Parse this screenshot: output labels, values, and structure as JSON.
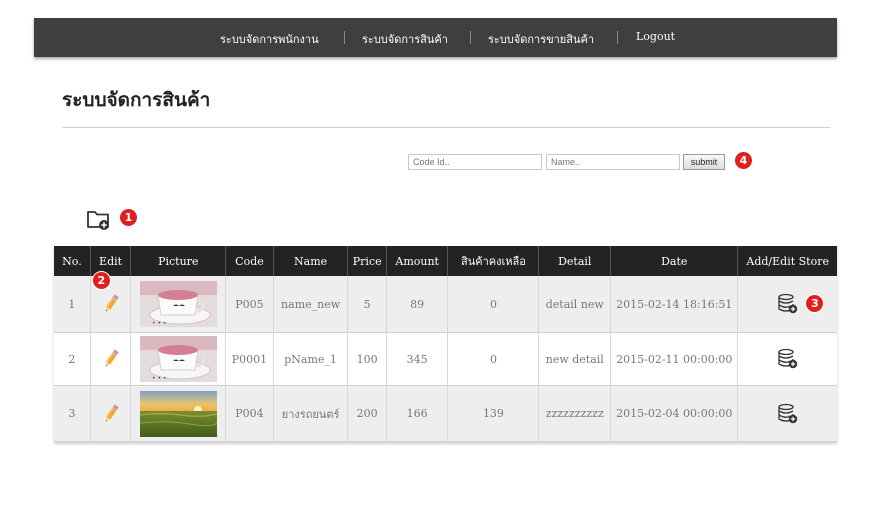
{
  "nav": {
    "items": [
      "ระบบจัดการพนักงาน",
      "ระบบจัดการสินค้า",
      "ระบบจัดการขายสินค้า",
      "Logout"
    ]
  },
  "page": {
    "title": "ระบบจัดการสินค้า"
  },
  "search": {
    "code_placeholder": "Code Id..",
    "name_placeholder": "Name..",
    "submit_label": "submit"
  },
  "callouts": {
    "one": "1",
    "two": "2",
    "three": "3",
    "four": "4"
  },
  "table": {
    "headers": [
      "No.",
      "Edit",
      "Picture",
      "Code",
      "Name",
      "Price",
      "Amount",
      "สินค้าคงเหลือ",
      "Detail",
      "Date",
      "Add/Edit Store"
    ],
    "rows": [
      {
        "no": "1",
        "code": "P005",
        "name": "name_new",
        "price": "5",
        "amount": "89",
        "remaining": "0",
        "detail": "detail new",
        "date": "2015-02-14 18:16:51",
        "picture": "mug-image"
      },
      {
        "no": "2",
        "code": "P0001",
        "name": "pName_1",
        "price": "100",
        "amount": "345",
        "remaining": "0",
        "detail": "new detail",
        "date": "2015-02-11 00:00:00",
        "picture": "mug-image"
      },
      {
        "no": "3",
        "code": "P004",
        "name": "ยางรถยนตร์",
        "price": "200",
        "amount": "166",
        "remaining": "139",
        "detail": "zzzzzzzzzz",
        "date": "2015-02-04 00:00:00",
        "picture": "field-image"
      }
    ]
  },
  "icons": {
    "add": "folder-add-icon",
    "edit": "pencil-icon",
    "store": "database-add-icon"
  },
  "colors": {
    "navbar": "#3f3f3f",
    "table_header": "#232323",
    "badge": "#e21f1f"
  }
}
